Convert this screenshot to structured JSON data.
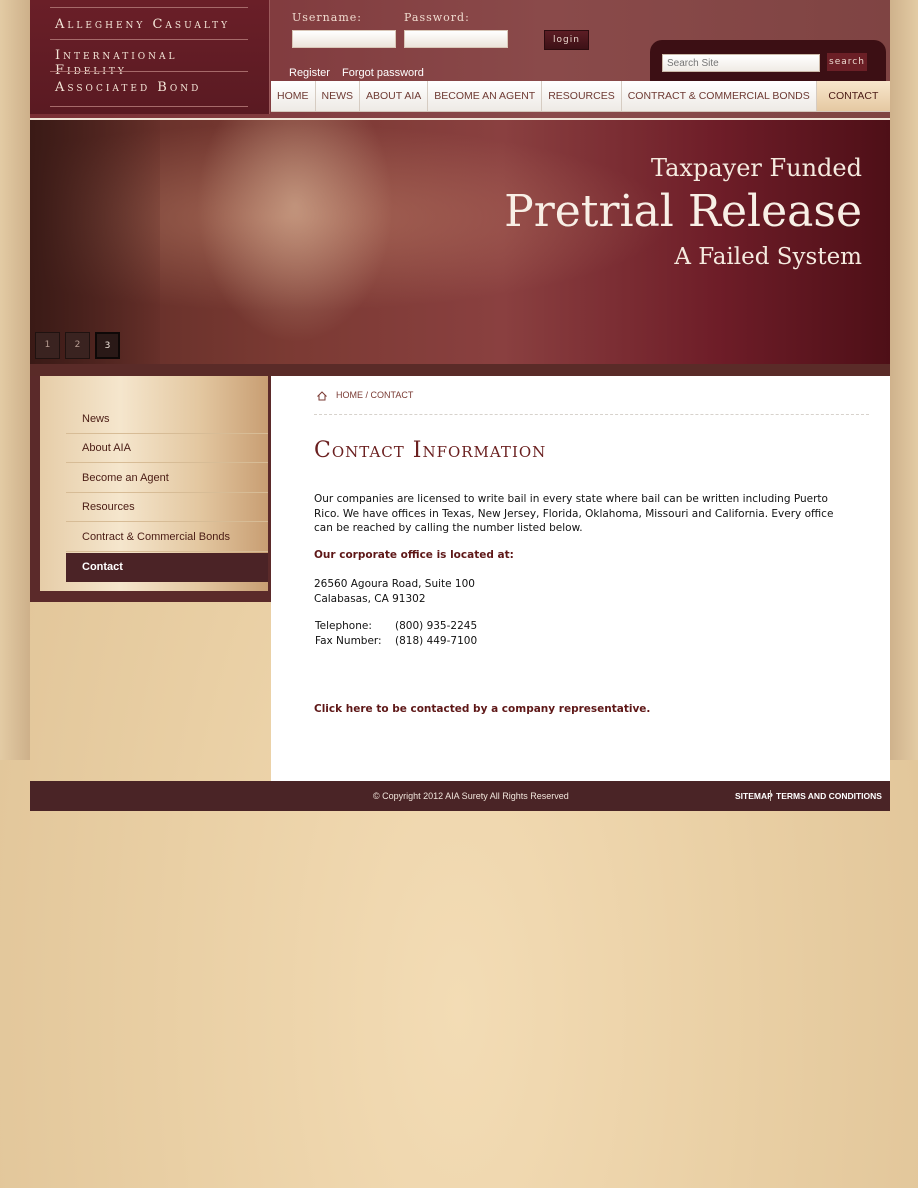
{
  "logo": {
    "line1": "Allegheny Casualty",
    "line2": "International Fidelity",
    "line3": "Associated Bond"
  },
  "login": {
    "username_label": "Username:",
    "password_label": "Password:",
    "username_value": "",
    "password_value": "",
    "login_button": "login",
    "register_link": "Register",
    "forgot_link": "Forgot password"
  },
  "search": {
    "placeholder": "Search Site",
    "button": "search"
  },
  "nav": {
    "items": [
      "HOME",
      "NEWS",
      "ABOUT AIA",
      "BECOME AN AGENT",
      "RESOURCES",
      "CONTRACT & COMMERCIAL BONDS",
      "CONTACT"
    ],
    "active": "CONTACT"
  },
  "hero": {
    "line1": "Taxpayer Funded",
    "line2": "Pretrial Release",
    "line3": "A Failed System",
    "slides": [
      "1",
      "2",
      "3"
    ],
    "active_slide": "3"
  },
  "sidebar": {
    "items": [
      "News",
      "About AIA",
      "Become an Agent",
      "Resources",
      "Contract & Commercial Bonds",
      "Contact"
    ],
    "active": "Contact"
  },
  "main": {
    "breadcrumb": "HOME / CONTACT",
    "title": "Contact Information",
    "intro": "Our companies are licensed to write bail in every state where bail can be written including Puerto Rico.  We have offices in Texas, New Jersey, Florida, Oklahoma, Missouri and California.  Every office can be reached by calling the number listed below.",
    "office_heading": "Our corporate office is located at:",
    "address_line1": "26560 Agoura Road, Suite 100",
    "address_line2": "Calabasas, CA 91302",
    "telephone_label": "Telephone:",
    "telephone_value": "(800) 935-2245",
    "fax_label": "Fax Number:",
    "fax_value": "(818) 449-7100",
    "contact_link": "Click here to be contacted by a company representative."
  },
  "footer": {
    "copyright": "© Copyright 2012 AIA Surety All Rights Reserved",
    "sitemap": "SITEMAP",
    "terms": "TERMS AND CONDITIONS"
  },
  "colors": {
    "brand_maroon": "#6a1f28",
    "footer_bg": "#4a2426",
    "accent_tan": "#e5c9a2"
  }
}
